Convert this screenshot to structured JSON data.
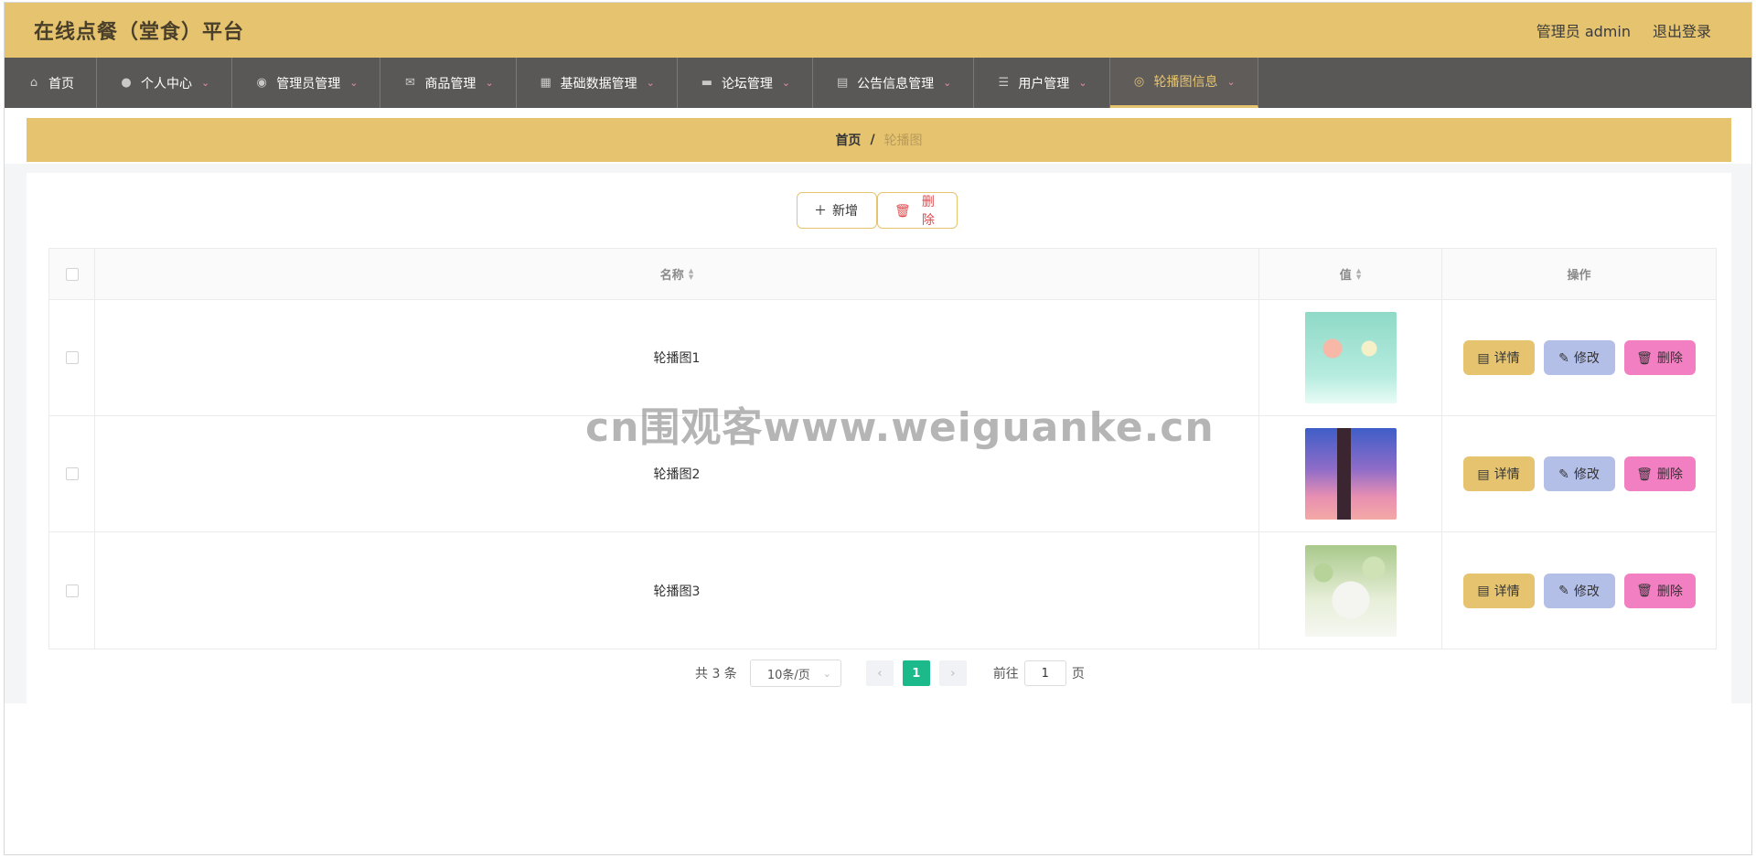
{
  "header": {
    "title": "在线点餐（堂食）平台",
    "user_label": "管理员 admin",
    "logout_label": "退出登录"
  },
  "nav": {
    "items": [
      {
        "label": "首页",
        "icon": "home-icon"
      },
      {
        "label": "个人中心",
        "icon": "user-icon"
      },
      {
        "label": "管理员管理",
        "icon": "location-icon"
      },
      {
        "label": "商品管理",
        "icon": "mail-icon"
      },
      {
        "label": "基础数据管理",
        "icon": "grid-icon"
      },
      {
        "label": "论坛管理",
        "icon": "briefcase-icon"
      },
      {
        "label": "公告信息管理",
        "icon": "clipboard-icon"
      },
      {
        "label": "用户管理",
        "icon": "sliders-icon"
      },
      {
        "label": "轮播图信息",
        "icon": "target-icon"
      }
    ],
    "active": "轮播图信息"
  },
  "breadcrumb": {
    "home": "首页",
    "separator": "/",
    "current": "轮播图"
  },
  "toolbar": {
    "add_label": "新增",
    "delete_label": "删除"
  },
  "table": {
    "columns": [
      "名称",
      "值",
      "操作"
    ],
    "rows": [
      {
        "name": "轮播图1",
        "value_image": "hot-air-balloons"
      },
      {
        "name": "轮播图2",
        "value_image": "windmill-sunset"
      },
      {
        "name": "轮播图3",
        "value_image": "white-flowers"
      }
    ],
    "row_actions": {
      "detail": "详情",
      "edit": "修改",
      "delete": "删除"
    }
  },
  "pagination": {
    "total": "共 3 条",
    "page_size": "10条/页",
    "current_page": "1",
    "goto_prefix": "前往",
    "goto_value": "1",
    "goto_suffix": "页"
  },
  "watermark": "cn围观客www.weiguanke.cn",
  "colors": {
    "accent": "#e6c46f",
    "nav_bg": "#5a5856",
    "detail": "#e6c46f",
    "edit": "#b4bfe8",
    "delete": "#f27fc2",
    "pager_active": "#1cb98a"
  }
}
